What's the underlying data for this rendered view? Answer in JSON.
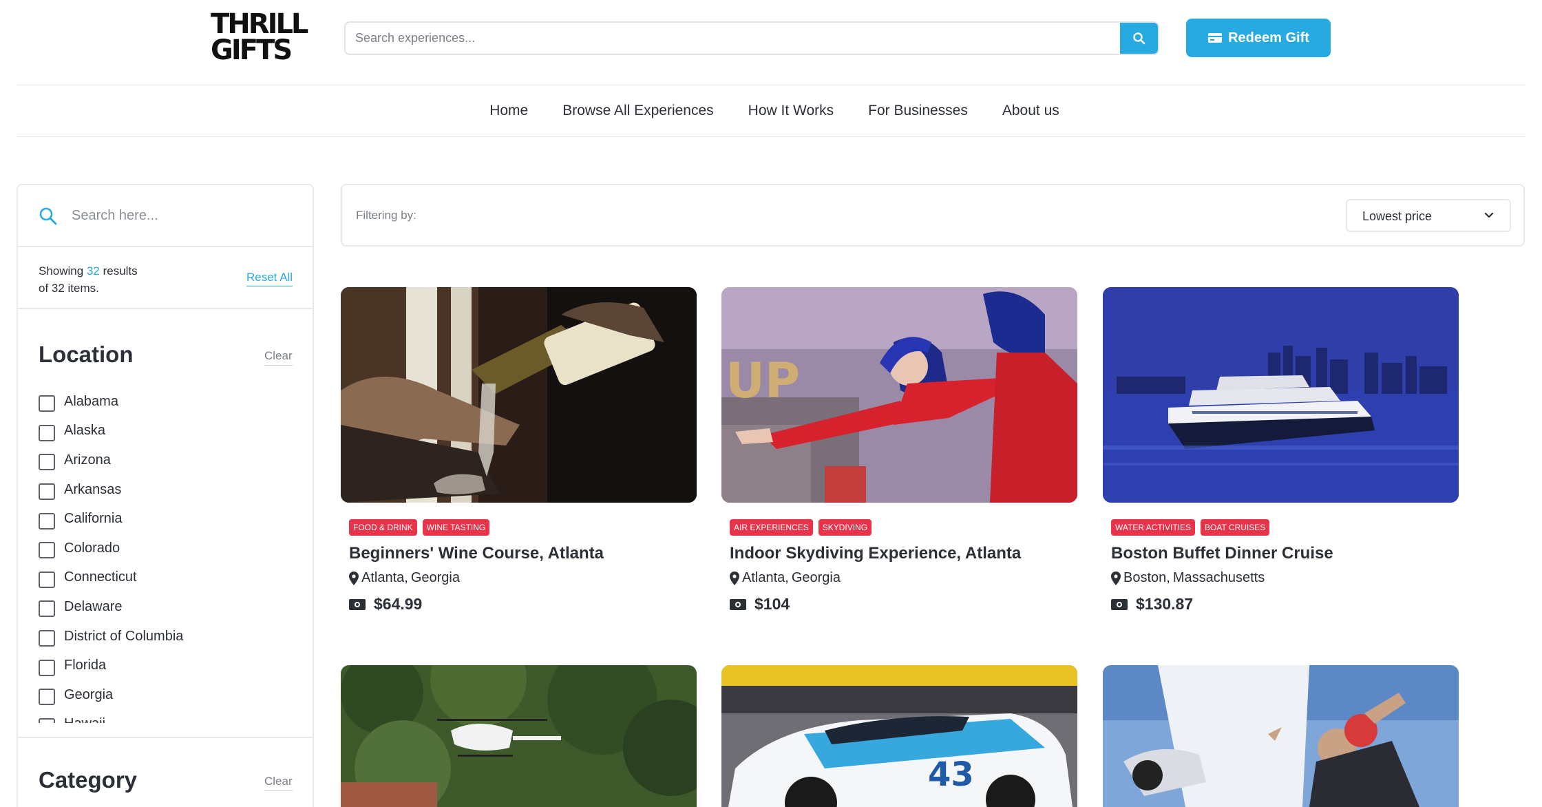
{
  "brand": {
    "logo_line1": "THRILL",
    "logo_line2": "GIFTS"
  },
  "header": {
    "search_placeholder": "Search experiences...",
    "redeem_label": "Redeem Gift",
    "accent_color": "#27a9e1"
  },
  "nav": {
    "items": [
      "Home",
      "Browse All Experiences",
      "How It Works",
      "For Businesses",
      "About us"
    ]
  },
  "sidebar": {
    "search_placeholder": "Search here...",
    "showing_prefix": "Showing",
    "showing_count": "32",
    "showing_suffix": "results",
    "showing_line2": "of 32 items.",
    "reset_label": "Reset All",
    "location_heading": "Location",
    "location_clear": "Clear",
    "locations": [
      "Alabama",
      "Alaska",
      "Arizona",
      "Arkansas",
      "California",
      "Colorado",
      "Connecticut",
      "Delaware",
      "District of Columbia",
      "Florida",
      "Georgia",
      "Hawaii"
    ],
    "category_heading": "Category",
    "category_clear": "Clear"
  },
  "filterbar": {
    "label": "Filtering by:",
    "sort_value": "Lowest price"
  },
  "cards": [
    {
      "tags": [
        "Food & Drink",
        "Wine Tasting"
      ],
      "title": "Beginners' Wine Course, Atlanta",
      "city": "Atlanta,",
      "state": "Georgia",
      "price": "$64.99",
      "image": "wine-pour"
    },
    {
      "tags": [
        "Air Experiences",
        "Skydiving"
      ],
      "title": "Indoor Skydiving Experience, Atlanta",
      "city": "Atlanta,",
      "state": "Georgia",
      "price": "$104",
      "image": "indoor-skydiving"
    },
    {
      "tags": [
        "Water Activities",
        "Boat Cruises"
      ],
      "title": "Boston Buffet Dinner Cruise",
      "city": "Boston,",
      "state": "Massachusetts",
      "price": "$130.87",
      "image": "boston-cruise"
    },
    {
      "image": "helicopter"
    },
    {
      "image": "race-car"
    },
    {
      "image": "tandem-skydive"
    }
  ],
  "tag_color": "#e8334a"
}
